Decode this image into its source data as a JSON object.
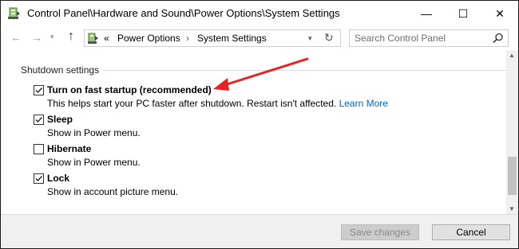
{
  "window": {
    "title": "Control Panel\\Hardware and Sound\\Power Options\\System Settings",
    "minimize_glyph": "—",
    "maximize_glyph": "☐",
    "close_glyph": "✕"
  },
  "navigation": {
    "back_glyph": "←",
    "forward_glyph": "→",
    "recent_glyph": "▾",
    "up_glyph": "↑",
    "breadcrumb_overflow": "«",
    "breadcrumbs": [
      "Power Options",
      "System Settings"
    ],
    "separator": "›",
    "refresh_glyph": "↻",
    "dropdown_glyph": "▾"
  },
  "search": {
    "placeholder": "Search Control Panel",
    "icon": "search-icon"
  },
  "shutdown": {
    "group_title": "Shutdown settings",
    "options": [
      {
        "label": "Turn on fast startup (recommended)",
        "description": "This helps start your PC faster after shutdown. Restart isn't affected.",
        "link": "Learn More",
        "checked": true
      },
      {
        "label": "Sleep",
        "description": "Show in Power menu.",
        "checked": true
      },
      {
        "label": "Hibernate",
        "description": "Show in Power menu.",
        "checked": false
      },
      {
        "label": "Lock",
        "description": "Show in account picture menu.",
        "checked": true
      }
    ]
  },
  "scrollbar": {
    "position": 0.85
  },
  "footer": {
    "save_label": "Save changes",
    "cancel_label": "Cancel"
  },
  "colors": {
    "link": "#0066cc",
    "annotation_arrow": "#e32424",
    "disabled_button": "#cccccc"
  }
}
